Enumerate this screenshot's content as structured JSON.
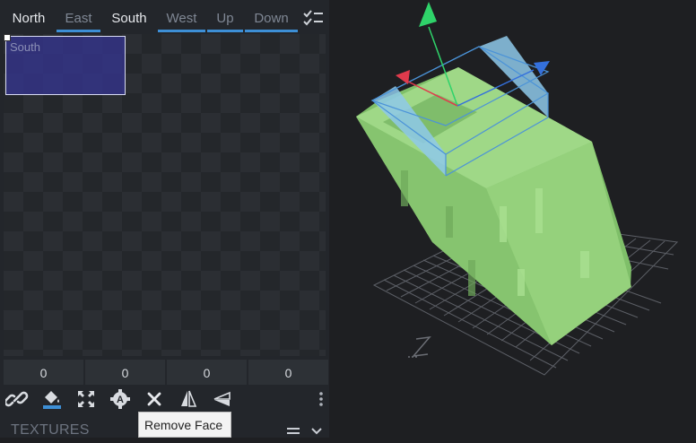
{
  "face_tabs": [
    {
      "label": "North",
      "state": "active"
    },
    {
      "label": "East",
      "state": "selected"
    },
    {
      "label": "South",
      "state": "active"
    },
    {
      "label": "West",
      "state": "selected"
    },
    {
      "label": "Up",
      "state": "selected"
    },
    {
      "label": "Down",
      "state": "selected"
    }
  ],
  "uv_editor": {
    "face_label": "South"
  },
  "uv_inputs": [
    "0",
    "0",
    "0",
    "0"
  ],
  "toolbar": {
    "tools": [
      "link-icon",
      "paint-bucket-icon",
      "maximize-icon",
      "auto-uv-icon",
      "remove-face-icon",
      "mirror-x-icon",
      "mirror-y-icon"
    ]
  },
  "textures_panel": {
    "title": "TEXTURES"
  },
  "tooltip": {
    "text": "Remove Face"
  },
  "colors": {
    "accent": "#3d8fd6",
    "model_green": "#8fcf78",
    "selection_face": "#8ec9ea"
  }
}
